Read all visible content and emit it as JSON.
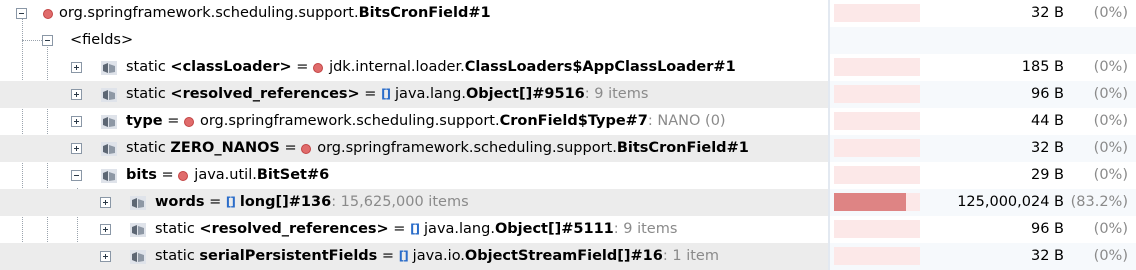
{
  "rows": [
    {
      "prefix": "",
      "name": "org.springframework.scheduling.support.",
      "name_bold": "BitsCronField#1",
      "size": "32 B",
      "pct": "(0%)"
    },
    {
      "label": "<fields>"
    },
    {
      "mod": "static ",
      "name_bold": "<classLoader>",
      "eq": " = ",
      "val": "jdk.internal.loader.",
      "val_bold": "ClassLoaders$AppClassLoader#1",
      "size": "185 B",
      "pct": "(0%)"
    },
    {
      "mod": "static ",
      "name_bold": "<resolved_references>",
      "eq": " = ",
      "val": "java.lang.",
      "val_bold": "Object[]#9516",
      "extra": ": 9 items",
      "size": "96 B",
      "pct": "(0%)"
    },
    {
      "mod": "",
      "name_bold": "type",
      "eq": " = ",
      "val": "org.springframework.scheduling.support.",
      "val_bold": "CronField$Type#7",
      "extra": ": NANO (0)",
      "size": "44 B",
      "pct": "(0%)"
    },
    {
      "mod": "static ",
      "name_bold": "ZERO_NANOS",
      "eq": " = ",
      "val": "org.springframework.scheduling.support.",
      "val_bold": "BitsCronField#1",
      "size": "32 B",
      "pct": "(0%)"
    },
    {
      "mod": "",
      "name_bold": "bits",
      "eq": " = ",
      "val": "java.util.",
      "val_bold": "BitSet#6",
      "size": "29 B",
      "pct": "(0%)"
    },
    {
      "mod": "",
      "name_bold": "words",
      "eq": " = ",
      "val": "",
      "val_bold": "long[]#136",
      "extra": ": 15,625,000 items",
      "size": "125,000,024 B",
      "pct": "(83.2%)"
    },
    {
      "mod": "static ",
      "name_bold": "<resolved_references>",
      "eq": " = ",
      "val": "java.lang.",
      "val_bold": "Object[]#5111",
      "extra": ": 9 items",
      "size": "96 B",
      "pct": "(0%)"
    },
    {
      "mod": "static ",
      "name_bold": "serialPersistentFields",
      "eq": " = ",
      "val": "java.io.",
      "val_bold": "ObjectStreamField[]#16",
      "extra": ": 1 item",
      "size": "32 B",
      "pct": "(0%)"
    }
  ],
  "bars": [
    0,
    0,
    0,
    0,
    0,
    0,
    0,
    0.832,
    0,
    0
  ],
  "colors": {
    "bar_bg": "#fce8e8",
    "bar_fill": "#de8484",
    "object_dot": "#e06b6b",
    "array_icon": "#2a6cc9"
  },
  "icons": {
    "object": "object-dot-icon",
    "field": "field-icon",
    "array": "array-icon",
    "expand": "expand-icon",
    "collapse": "collapse-icon"
  }
}
